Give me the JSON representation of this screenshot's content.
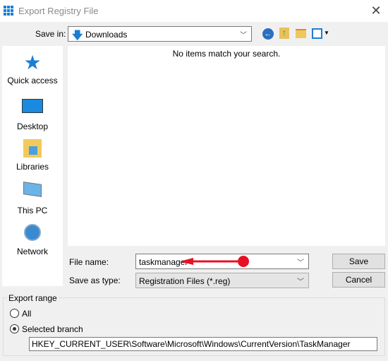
{
  "window": {
    "title": "Export Registry File",
    "close_icon": "close-icon"
  },
  "toolbar": {
    "save_in_label": "Save in:",
    "save_in_value": "Downloads",
    "icons": [
      "back-icon",
      "up-folder-icon",
      "new-folder-icon",
      "view-menu-icon"
    ]
  },
  "list": {
    "empty_message": "No items match your search."
  },
  "sidebar": {
    "items": [
      {
        "label": "Quick access",
        "icon": "star-icon"
      },
      {
        "label": "Desktop",
        "icon": "desktop-icon"
      },
      {
        "label": "Libraries",
        "icon": "libraries-icon"
      },
      {
        "label": "This PC",
        "icon": "computer-icon"
      },
      {
        "label": "Network",
        "icon": "network-icon"
      }
    ]
  },
  "form": {
    "file_name_label": "File name:",
    "file_name_value": "taskmanager",
    "save_type_label": "Save as type:",
    "save_type_value": "Registration Files (*.reg)",
    "save_button": "Save",
    "cancel_button": "Cancel"
  },
  "annotation": {
    "color": "#e81123"
  },
  "export_range": {
    "label": "Export range",
    "all_label": "All",
    "selected_label": "Selected branch",
    "selected": "Selected branch",
    "branch_value": "HKEY_CURRENT_USER\\Software\\Microsoft\\Windows\\CurrentVersion\\TaskManager"
  }
}
